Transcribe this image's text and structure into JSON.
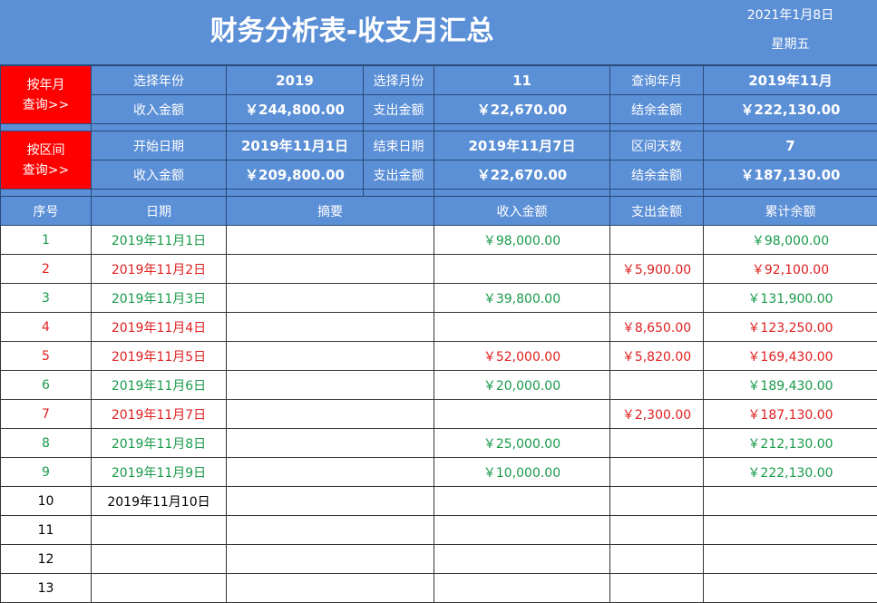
{
  "header": {
    "title": "财务分析表-收支月汇总",
    "date": "2021年1月8日",
    "weekday": "星期五"
  },
  "month_query": {
    "button_line1": "按年月",
    "button_line2": "查询>>",
    "year_label": "选择年份",
    "year_value": "2019",
    "month_label": "选择月份",
    "month_value": "11",
    "period_label": "查询年月",
    "period_value": "2019年11月",
    "income_label": "收入金额",
    "income_value": "￥244,800.00",
    "expense_label": "支出金额",
    "expense_value": "￥22,670.00",
    "balance_label": "结余金额",
    "balance_value": "￥222,130.00"
  },
  "range_query": {
    "button_line1": "按区间",
    "button_line2": "查询>>",
    "start_label": "开始日期",
    "start_value": "2019年11月1日",
    "end_label": "结束日期",
    "end_value": "2019年11月7日",
    "days_label": "区间天数",
    "days_value": "7",
    "income_label": "收入金额",
    "income_value": "￥209,800.00",
    "expense_label": "支出金额",
    "expense_value": "￥22,670.00",
    "balance_label": "结余金额",
    "balance_value": "￥187,130.00"
  },
  "table": {
    "columns": [
      "序号",
      "日期",
      "摘要",
      "收入金额",
      "支出金额",
      "累计余额"
    ],
    "rows": [
      {
        "type": "inc",
        "no": "1",
        "date": "2019年11月1日",
        "memo": "",
        "income": "￥98,000.00",
        "expense": "",
        "balance": "￥98,000.00"
      },
      {
        "type": "exp",
        "no": "2",
        "date": "2019年11月2日",
        "memo": "",
        "income": "",
        "expense": "￥5,900.00",
        "balance": "￥92,100.00"
      },
      {
        "type": "inc",
        "no": "3",
        "date": "2019年11月3日",
        "memo": "",
        "income": "￥39,800.00",
        "expense": "",
        "balance": "￥131,900.00"
      },
      {
        "type": "exp",
        "no": "4",
        "date": "2019年11月4日",
        "memo": "",
        "income": "",
        "expense": "￥8,650.00",
        "balance": "￥123,250.00"
      },
      {
        "type": "exp",
        "no": "5",
        "date": "2019年11月5日",
        "memo": "",
        "income": "￥52,000.00",
        "expense": "￥5,820.00",
        "balance": "￥169,430.00"
      },
      {
        "type": "inc",
        "no": "6",
        "date": "2019年11月6日",
        "memo": "",
        "income": "￥20,000.00",
        "expense": "",
        "balance": "￥189,430.00"
      },
      {
        "type": "exp",
        "no": "7",
        "date": "2019年11月7日",
        "memo": "",
        "income": "",
        "expense": "￥2,300.00",
        "balance": "￥187,130.00"
      },
      {
        "type": "inc",
        "no": "8",
        "date": "2019年11月8日",
        "memo": "",
        "income": "￥25,000.00",
        "expense": "",
        "balance": "￥212,130.00"
      },
      {
        "type": "inc",
        "no": "9",
        "date": "2019年11月9日",
        "memo": "",
        "income": "￥10,000.00",
        "expense": "",
        "balance": "￥222,130.00"
      },
      {
        "type": "plain",
        "no": "10",
        "date": "2019年11月10日",
        "memo": "",
        "income": "",
        "expense": "",
        "balance": ""
      },
      {
        "type": "plain",
        "no": "11",
        "date": "",
        "memo": "",
        "income": "",
        "expense": "",
        "balance": ""
      },
      {
        "type": "plain",
        "no": "12",
        "date": "",
        "memo": "",
        "income": "",
        "expense": "",
        "balance": ""
      },
      {
        "type": "plain",
        "no": "13",
        "date": "",
        "memo": "",
        "income": "",
        "expense": "",
        "balance": ""
      }
    ]
  },
  "colors": {
    "header_blue": "#5b8fd6",
    "button_red": "#ff0000",
    "income_green": "#1a9a4a",
    "expense_red": "#e02020"
  }
}
